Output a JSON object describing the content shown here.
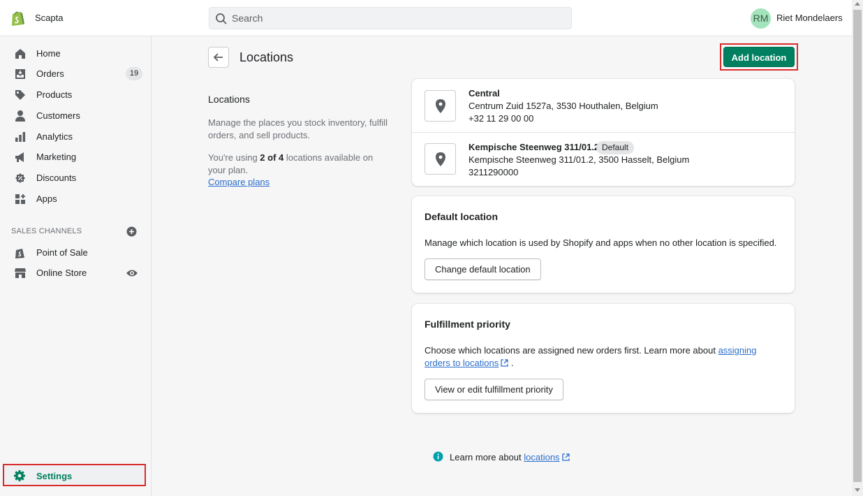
{
  "header": {
    "store_name": "Scapta",
    "search_placeholder": "Search",
    "user_initials": "RM",
    "user_name": "Riet Mondelaers"
  },
  "sidebar": {
    "items": [
      {
        "label": "Home",
        "icon": "home-icon"
      },
      {
        "label": "Orders",
        "icon": "orders-icon",
        "badge": "19"
      },
      {
        "label": "Products",
        "icon": "tag-icon"
      },
      {
        "label": "Customers",
        "icon": "person-icon"
      },
      {
        "label": "Analytics",
        "icon": "bar-chart-icon"
      },
      {
        "label": "Marketing",
        "icon": "megaphone-icon"
      },
      {
        "label": "Discounts",
        "icon": "discount-icon"
      },
      {
        "label": "Apps",
        "icon": "apps-icon"
      }
    ],
    "sales_channels_label": "SALES CHANNELS",
    "channels": [
      {
        "label": "Point of Sale",
        "icon": "shopify-bag-icon"
      },
      {
        "label": "Online Store",
        "icon": "store-icon"
      }
    ],
    "settings_label": "Settings"
  },
  "page": {
    "title": "Locations",
    "add_button": "Add location"
  },
  "annotation": {
    "title": "Locations",
    "description": "Manage the places you stock inventory, fulfill orders, and sell products.",
    "usage_prefix": "You're using ",
    "usage_used": "2 of 4",
    "usage_suffix": " locations available on your plan.",
    "compare_link": "Compare plans"
  },
  "locations": [
    {
      "name": "Central",
      "address": "Centrum Zuid 1527a, 3530 Houthalen, Belgium",
      "phone": "+32 11 29 00 00",
      "badge": ""
    },
    {
      "name": "Kempische Steenweg 311/01.2",
      "address": "Kempische Steenweg 311/01.2, 3500 Hasselt, Belgium",
      "phone": "3211290000",
      "badge": "Default"
    }
  ],
  "default_location": {
    "title": "Default location",
    "description": "Manage which location is used by Shopify and apps when no other location is specified.",
    "button": "Change default location"
  },
  "fulfillment": {
    "title": "Fulfillment priority",
    "description_prefix": "Choose which locations are assigned new orders first. Learn more about ",
    "link": "assigning orders to locations",
    "description_suffix": " .",
    "button": "View or edit fulfillment priority"
  },
  "footer": {
    "prefix": "Learn more about ",
    "link": "locations"
  },
  "colors": {
    "primary": "#008060",
    "link": "#2c6ecb",
    "highlight": "#d82c2c"
  }
}
